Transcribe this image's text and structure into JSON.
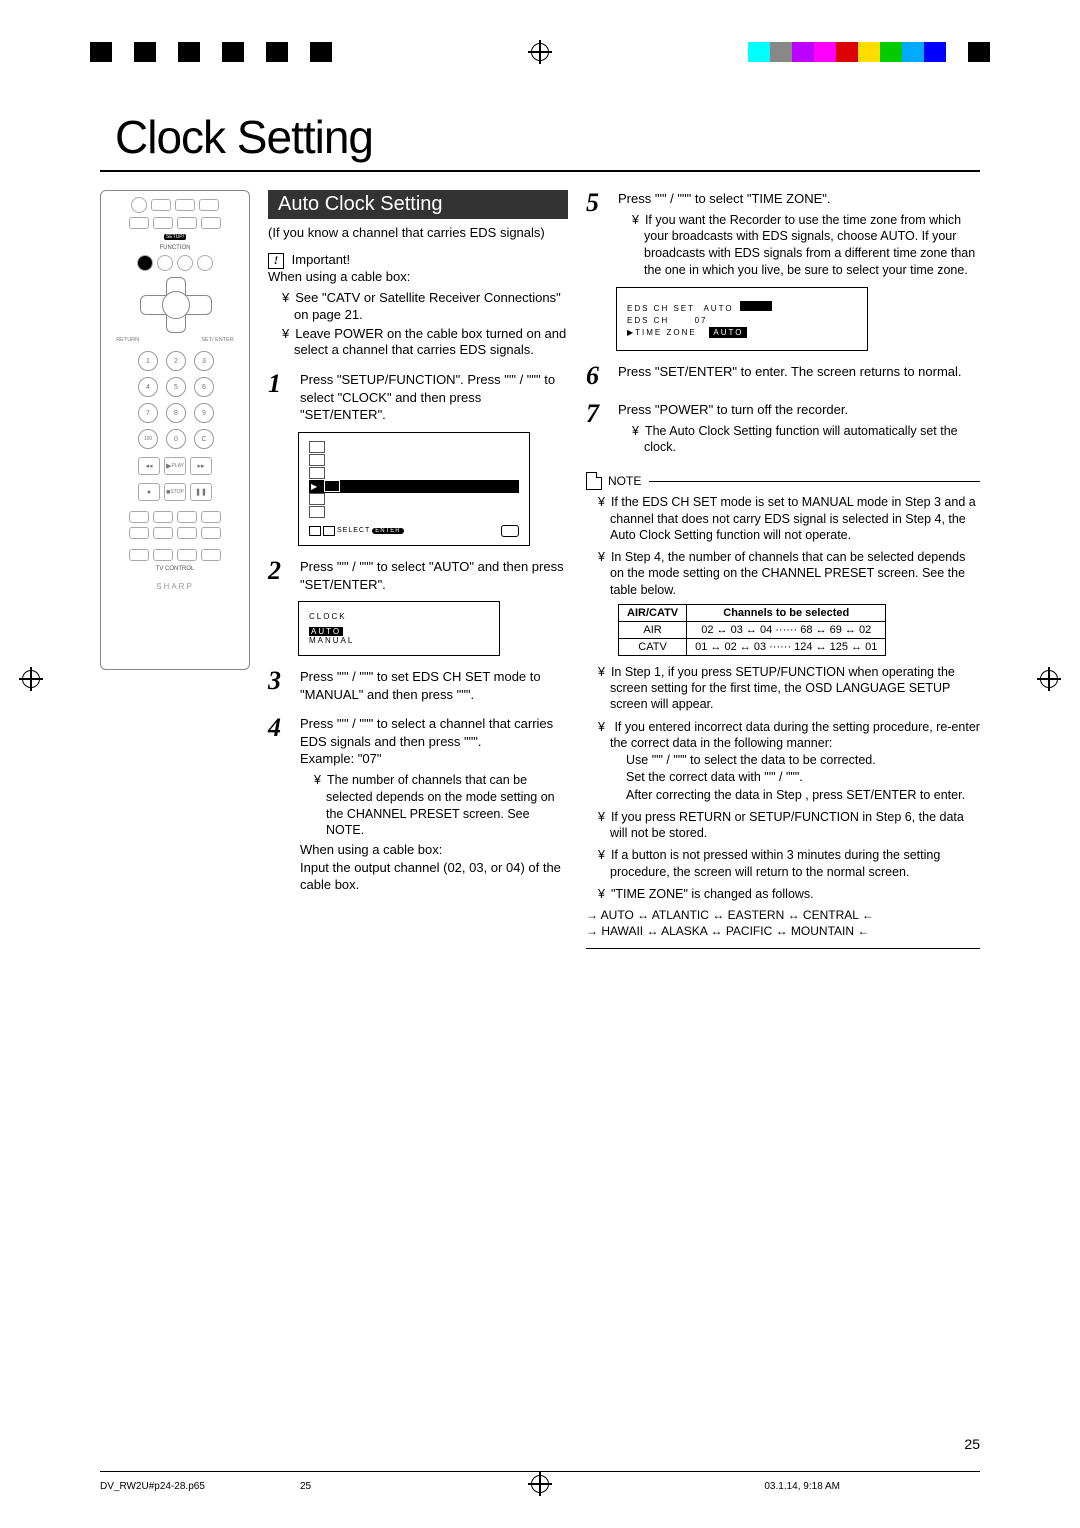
{
  "page_title": "Clock Setting",
  "section_title": "Auto Clock Setting",
  "intro": "(If you know a channel that carries EDS signals)",
  "important_label": "Important!",
  "important_when": "When using a cable box:",
  "important_items": [
    "See \"CATV or Satellite Receiver Connections\" on page 21.",
    "Leave POWER on the cable box turned on and select a channel that carries EDS signals."
  ],
  "steps": {
    "s1": "Press \"SETUP/FUNCTION\". Press \"'\" / \"\"\" to select \"CLOCK\" and then press \"SET/ENTER\".",
    "s2": "Press \"'\" / \"\"\" to select \"AUTO\" and then press \"SET/ENTER\".",
    "s3": "Press \"'\" / \"\"\" to set EDS CH SET mode to \"MANUAL\" and then press \"\"\".",
    "s4": "Press \"'\" / \"\"\" to select a channel that carries EDS signals and then press \"\"\".",
    "s4_example": "Example: \"07\"",
    "s4_notes": [
      "The number of channels that can be selected depends on the mode setting on the CHANNEL PRESET screen. See NOTE."
    ],
    "s4_extra_when": "When using a cable box:",
    "s4_extra": "Input the output channel (02, 03, or 04) of the cable box.",
    "s5": "Press \"'\" / \"\"\" to select \"TIME ZONE\".",
    "s5_notes": [
      "If you want the Recorder to use the time zone from which your broadcasts with EDS signals, choose AUTO. If your broadcasts with EDS signals from a different time zone than the one in which you live, be sure to select your time zone."
    ],
    "s6": "Press \"SET/ENTER\" to enter. The screen returns to normal.",
    "s7": "Press \"POWER\" to turn off the recorder.",
    "s7_notes": [
      "The Auto Clock Setting function will automatically set the clock."
    ]
  },
  "osd": {
    "footer_select": "SELECT",
    "footer_enter": "ENTER",
    "clock_title": "CLOCK",
    "clock_auto": "AUTO",
    "clock_manual": "MANUAL",
    "eds_set": "EDS CH SET",
    "eds_set_val": "AUTO",
    "eds_ch": "EDS CH",
    "eds_ch_val": "07",
    "tz": "TIME ZONE",
    "tz_val": "AUTO"
  },
  "note_label": "NOTE",
  "notes": {
    "n1": "If the EDS CH SET mode is set to MANUAL mode in Step 3 and a channel that does not carry EDS signal is selected in Step 4, the Auto Clock Setting function will not operate.",
    "n2": "In Step 4, the number of channels that can be selected depends on the mode setting on the CHANNEL PRESET screen. See the table below.",
    "n3": "In Step 1, if you press SETUP/FUNCTION when operating the screen setting for the first time, the OSD LANGUAGE SETUP screen will appear.",
    "n4": "If you entered incorrect data during the setting procedure, re-enter the correct data in the following manner:",
    "n4_sub1": "Use \"'\" / \"\"\" to select the data to be corrected.",
    "n4_sub2": "Set the correct data with \"'\" / \"\"\".",
    "n4_sub3": "After correcting the data in Step      , press SET/ENTER to enter.",
    "n5": "If you press RETURN or SETUP/FUNCTION in Step 6, the data will not be stored.",
    "n6": "If a button is not pressed within 3 minutes during the setting procedure, the screen will return to the normal screen.",
    "n7": "\"TIME ZONE\" is changed as follows."
  },
  "ch_table": {
    "h1": "AIR/CATV",
    "h2": "Channels to be selected",
    "r1a": "AIR",
    "r1b": "02 ↔ 03 ↔ 04  ······  68 ↔ 69 ↔ 02",
    "r2a": "CATV",
    "r2b": "01 ↔ 02 ↔ 03  ······ 124 ↔ 125 ↔ 01"
  },
  "tz_cycle_line1": "→ AUTO ↔ ATLANTIC ↔ EASTERN ↔ CENTRAL ←",
  "tz_cycle_line2": "→ HAWAII ↔ ALASKA ↔ PACIFIC ↔ MOUNTAIN ←",
  "page_number": "25",
  "footer": {
    "file": "DV_RW2U#p24-28.p65",
    "page": "25",
    "date": "03.1.14, 9:18 AM"
  },
  "remote": {
    "setup": "SETUP/",
    "function": "FUNCTION",
    "set_enter": "SET/\nENTER",
    "return": "RETURN",
    "play": "PLAY",
    "stop": "STOP",
    "tvcontrol": "TV CONTROL",
    "brand": "SHARP"
  }
}
